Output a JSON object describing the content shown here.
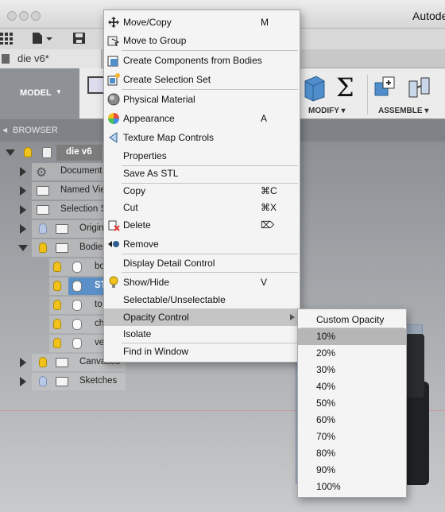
{
  "app": {
    "title": "Autodes"
  },
  "document_tab": {
    "label": "die v6*"
  },
  "ribbon": {
    "model_label": "MODEL",
    "modify_label": "MODIFY",
    "assemble_label": "ASSEMBLE"
  },
  "browser": {
    "title": "BROWSER",
    "items": [
      {
        "label": "die v6"
      },
      {
        "label": "Document"
      },
      {
        "label": "Named Vie"
      },
      {
        "label": "Selection S"
      },
      {
        "label": "Origin"
      },
      {
        "label": "Bodie"
      },
      {
        "label": "bo"
      },
      {
        "label": "ST"
      },
      {
        "label": "to"
      },
      {
        "label": "ch"
      },
      {
        "label": "ve"
      },
      {
        "label": "Canvases"
      },
      {
        "label": "Sketches"
      }
    ]
  },
  "context_menu": {
    "items": [
      {
        "label": "Move/Copy",
        "shortcut": "M",
        "icon": "move-icon"
      },
      {
        "label": "Move to Group",
        "shortcut": "",
        "icon": "move-group-icon"
      },
      {
        "label": "Create Components from Bodies",
        "shortcut": "",
        "icon": "component-icon"
      },
      {
        "label": "Create Selection Set",
        "shortcut": "",
        "icon": "selection-set-icon"
      },
      {
        "label": "Physical Material",
        "shortcut": "",
        "icon": "material-icon"
      },
      {
        "label": "Appearance",
        "shortcut": "A",
        "icon": "appearance-icon"
      },
      {
        "label": "Texture Map Controls",
        "shortcut": "",
        "icon": "texture-icon"
      },
      {
        "label": "Properties",
        "shortcut": "",
        "icon": ""
      },
      {
        "label": "Save As STL",
        "shortcut": "",
        "icon": ""
      },
      {
        "label": "Copy",
        "shortcut": "⌘C",
        "icon": ""
      },
      {
        "label": "Cut",
        "shortcut": "⌘X",
        "icon": ""
      },
      {
        "label": "Delete",
        "shortcut": "⌦",
        "icon": "delete-icon"
      },
      {
        "label": "Remove",
        "shortcut": "",
        "icon": "remove-icon"
      },
      {
        "label": "Display Detail Control",
        "shortcut": "",
        "icon": ""
      },
      {
        "label": "Show/Hide",
        "shortcut": "V",
        "icon": "lightbulb-icon"
      },
      {
        "label": "Selectable/Unselectable",
        "shortcut": "",
        "icon": ""
      },
      {
        "label": "Opacity Control",
        "shortcut": "",
        "icon": ""
      },
      {
        "label": "Isolate",
        "shortcut": "",
        "icon": ""
      },
      {
        "label": "Find in Window",
        "shortcut": "",
        "icon": ""
      }
    ]
  },
  "opacity_submenu": {
    "items": [
      {
        "label": "Custom Opacity"
      },
      {
        "label": "10%"
      },
      {
        "label": "20%"
      },
      {
        "label": "30%"
      },
      {
        "label": "40%"
      },
      {
        "label": "50%"
      },
      {
        "label": "60%"
      },
      {
        "label": "70%"
      },
      {
        "label": "80%"
      },
      {
        "label": "90%"
      },
      {
        "label": "100%"
      }
    ],
    "highlighted": "10%"
  }
}
